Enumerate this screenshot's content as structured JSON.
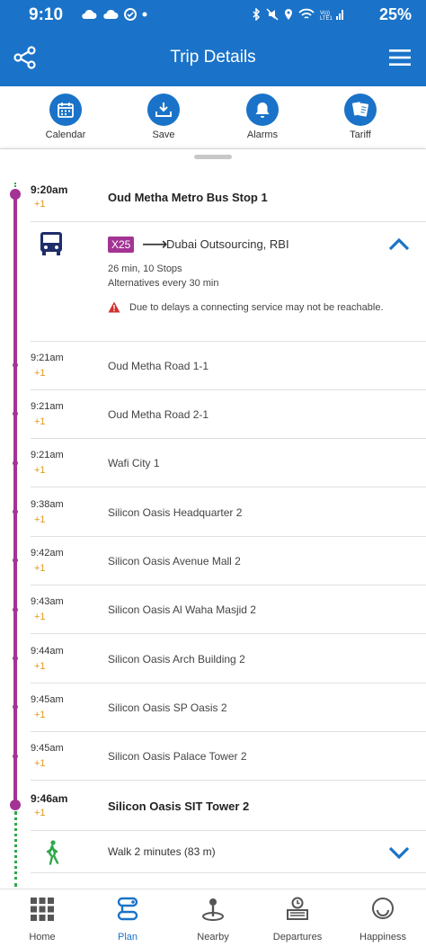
{
  "status_bar": {
    "time": "9:10",
    "battery": "25%"
  },
  "header": {
    "title": "Trip Details"
  },
  "actions": [
    {
      "label": "Calendar",
      "icon": "calendar-icon"
    },
    {
      "label": "Save",
      "icon": "save-icon"
    },
    {
      "label": "Alarms",
      "icon": "bell-icon"
    },
    {
      "label": "Tariff",
      "icon": "tickets-icon"
    }
  ],
  "origin": {
    "time": "9:20am",
    "delay": "+1",
    "name": "Oud Metha Metro Bus Stop 1"
  },
  "leg": {
    "route": "X25",
    "destination": "Dubai Outsourcing, RBI",
    "duration": "26 min, 10 Stops",
    "frequency": "Alternatives every 30 min",
    "warning": "Due to delays a connecting service may not be reachable."
  },
  "stops": [
    {
      "time": "9:21am",
      "delay": "+1",
      "name": "Oud Metha Road 1-1"
    },
    {
      "time": "9:21am",
      "delay": "+1",
      "name": "Oud Metha Road 2-1"
    },
    {
      "time": "9:21am",
      "delay": "+1",
      "name": "Wafi City 1"
    },
    {
      "time": "9:38am",
      "delay": "+1",
      "name": "Silicon Oasis Headquarter 2"
    },
    {
      "time": "9:42am",
      "delay": "+1",
      "name": "Silicon Oasis Avenue Mall 2"
    },
    {
      "time": "9:43am",
      "delay": "+1",
      "name": "Silicon Oasis Al Waha Masjid 2"
    },
    {
      "time": "9:44am",
      "delay": "+1",
      "name": "Silicon Oasis Arch Building 2"
    },
    {
      "time": "9:45am",
      "delay": "+1",
      "name": "Silicon Oasis SP Oasis 2"
    },
    {
      "time": "9:45am",
      "delay": "+1",
      "name": "Silicon Oasis Palace Tower 2"
    }
  ],
  "destination": {
    "time": "9:46am",
    "delay": "+1",
    "name": "Silicon Oasis SIT Tower 2"
  },
  "walk": {
    "text": "Walk 2 minutes (83 m)"
  },
  "nav": [
    {
      "label": "Home",
      "icon": "home-grid-icon"
    },
    {
      "label": "Plan",
      "icon": "route-plan-icon",
      "active": true
    },
    {
      "label": "Nearby",
      "icon": "nearby-pin-icon"
    },
    {
      "label": "Departures",
      "icon": "departures-board-icon"
    },
    {
      "label": "Happiness",
      "icon": "smiley-icon"
    }
  ],
  "colors": {
    "brand": "#1a73c8",
    "route": "#a33494",
    "delay": "#e39a1a",
    "walk": "#2ea84a",
    "warning": "#d32f2f"
  }
}
